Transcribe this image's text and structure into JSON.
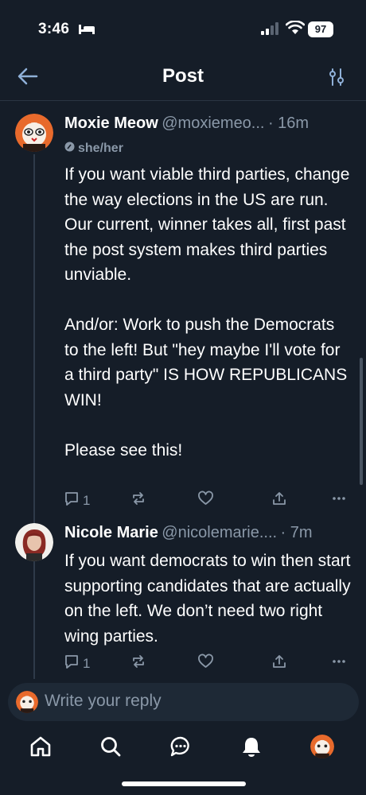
{
  "status_bar": {
    "time": "3:46",
    "battery": "97"
  },
  "header": {
    "title": "Post"
  },
  "posts": [
    {
      "name": "Moxie Meow",
      "handle": "@moxiemeo...",
      "time": "· 16m",
      "pronouns": "she/her",
      "text": "If you want viable third parties, change the way elections in the US are run. Our current, winner takes all, first past the post system makes third parties unviable.\n\nAnd/or: Work to push the Democrats to the left! But \"hey maybe I'll vote for a third party\" IS HOW REPUBLICANS WIN!\n\nPlease see this!",
      "reply_count": "1"
    },
    {
      "name": "Nicole Marie",
      "handle": "@nicolemarie....",
      "time": "· 7m",
      "text": "If you want democrats to win then start supporting candidates that are actually on the left. We don’t need two right wing parties.",
      "reply_count": "1"
    }
  ],
  "reply": {
    "placeholder": "Write your reply"
  },
  "icons": {
    "status": [
      "bed-icon",
      "signal-icon",
      "wifi-icon",
      "battery-icon"
    ],
    "header": [
      "back-arrow-icon",
      "filter-icon"
    ],
    "actions": [
      "reply-icon",
      "repost-icon",
      "like-icon",
      "share-icon",
      "more-icon"
    ],
    "nav": [
      "home-icon",
      "search-icon",
      "chat-icon",
      "notifications-icon",
      "profile-avatar"
    ]
  },
  "colors": {
    "background": "#151d28",
    "text_primary": "#ffffff",
    "text_secondary": "#8a98a8",
    "reply_bar": "#1e2936"
  }
}
